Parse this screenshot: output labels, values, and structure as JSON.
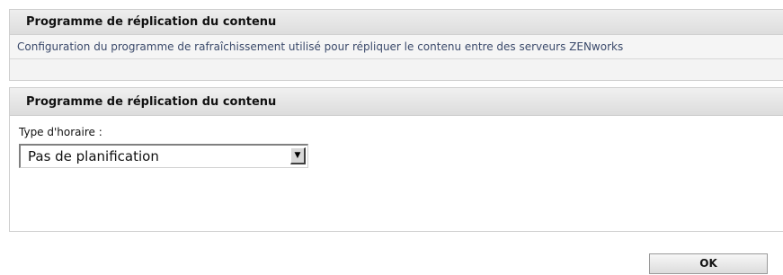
{
  "info": {
    "title": "Programme de réplication du contenu",
    "description": "Configuration du programme de rafraîchissement utilisé pour répliquer le contenu entre des serveurs ZENworks"
  },
  "schedule": {
    "title": "Programme de réplication du contenu",
    "type_label": "Type d'horaire :",
    "type_value": "Pas de planification",
    "arrow_icon": "dropdown-arrow-icon"
  },
  "actions": {
    "ok_label": "OK"
  }
}
